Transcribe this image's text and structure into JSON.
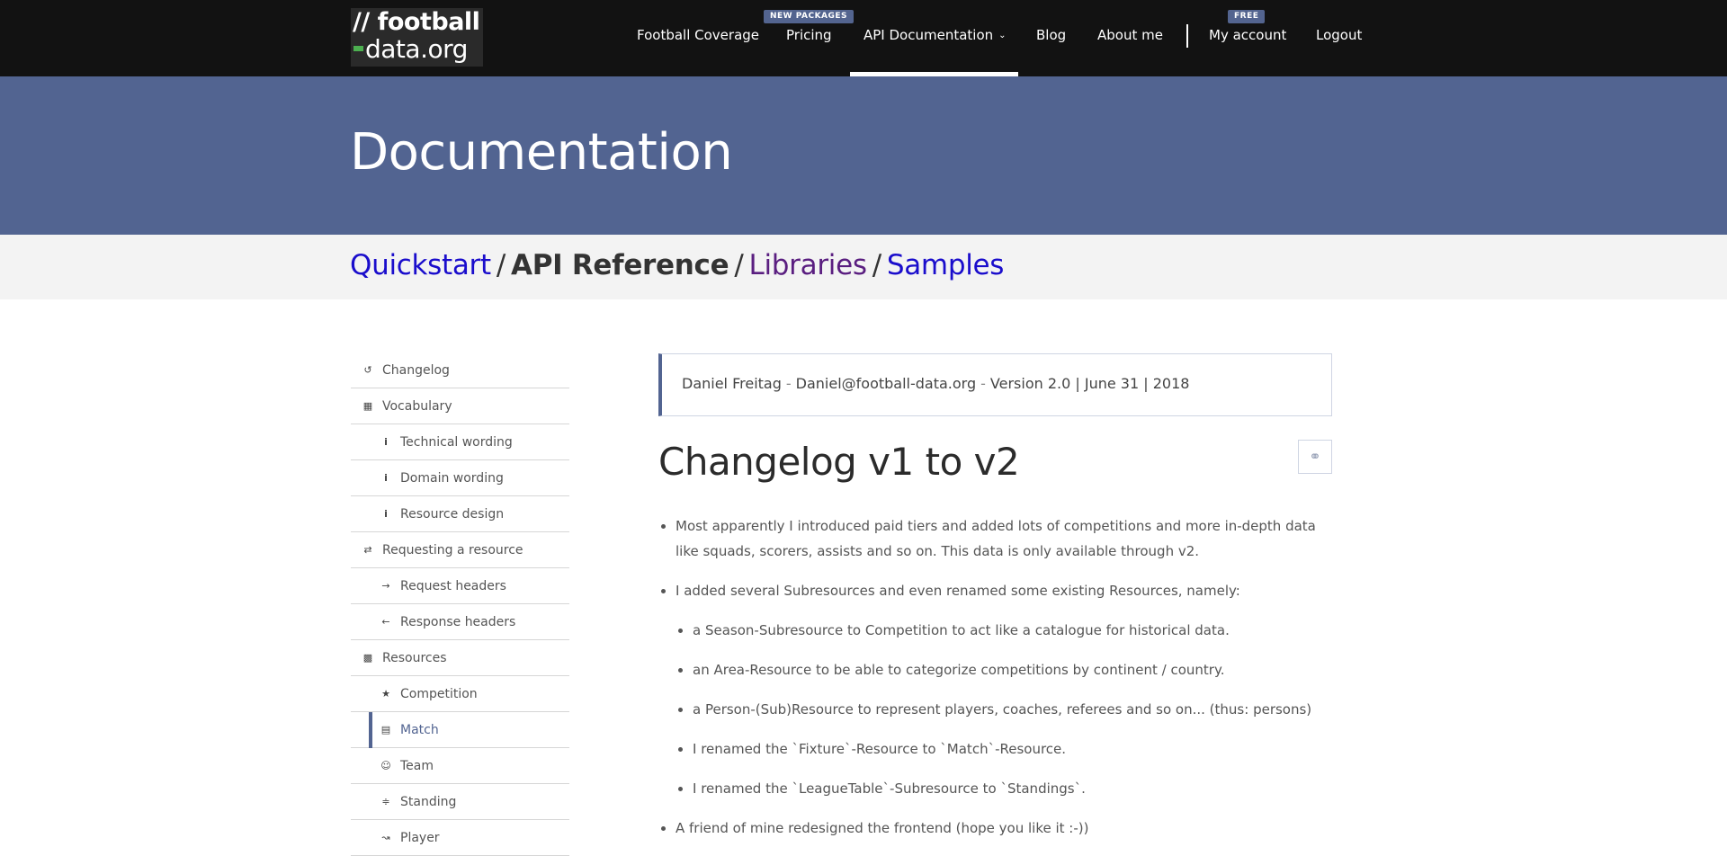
{
  "logo": {
    "line1": "// football",
    "line2": "data.org"
  },
  "nav": {
    "items": [
      {
        "label": "Football Coverage"
      },
      {
        "label": "Pricing",
        "badge": "NEW PACKAGES"
      },
      {
        "label": "API Documentation"
      },
      {
        "label": "Blog"
      },
      {
        "label": "About me"
      },
      {
        "label": "My account",
        "badge": "FREE"
      },
      {
        "label": "Logout"
      }
    ]
  },
  "hero": {
    "title": "Documentation"
  },
  "breadcrumb": {
    "items": [
      {
        "label": "Quickstart"
      },
      {
        "label": "API Reference"
      },
      {
        "label": "Libraries"
      },
      {
        "label": "Samples"
      }
    ],
    "separator": "/"
  },
  "sidebar": {
    "items": [
      {
        "label": "Changelog",
        "icon": "history-icon"
      },
      {
        "label": "Vocabulary",
        "icon": "language-icon"
      },
      {
        "label": "Technical wording",
        "icon": "info-icon"
      },
      {
        "label": "Domain wording",
        "icon": "info-icon"
      },
      {
        "label": "Resource design",
        "icon": "info-icon"
      },
      {
        "label": "Requesting a resource",
        "icon": "exchange-icon"
      },
      {
        "label": "Request headers",
        "icon": "arrow-right-icon"
      },
      {
        "label": "Response headers",
        "icon": "arrow-left-icon"
      },
      {
        "label": "Resources",
        "icon": "cubes-icon"
      },
      {
        "label": "Competition",
        "icon": "trophy-icon"
      },
      {
        "label": "Match",
        "icon": "calendar-icon",
        "active": true
      },
      {
        "label": "Team",
        "icon": "users-icon"
      },
      {
        "label": "Standing",
        "icon": "area-chart-icon"
      },
      {
        "label": "Player",
        "icon": "line-chart-icon"
      }
    ]
  },
  "author": {
    "name": "Daniel Freitag",
    "separator": "-",
    "email": "Daniel@football-data.org",
    "version_info": "Version 2.0 | June 31 | 2018"
  },
  "section": {
    "title": "Changelog v1 to v2",
    "anchor_icon": "link-icon",
    "items": [
      "Most apparently I introduced paid tiers and added lots of competitions and more in-depth data like squads, scorers, assists and so on. This data is only available through v2.",
      "I added several Subresources and even renamed some existing Resources, namely:",
      "A friend of mine redesigned the frontend (hope you like it :-))"
    ],
    "subitems": [
      "a Season-Subresource to Competition to act like a catalogue for historical data.",
      "an Area-Resource to be able to categorize competitions by continent / country.",
      "a Person-(Sub)Resource to represent players, coaches, referees and so on... (thus: persons)",
      "I renamed the `Fixture`-Resource to `Match`-Resource.",
      "I renamed the `LeagueTable`-Subresource to `Standings`."
    ]
  },
  "colors": {
    "navbar": "#121212",
    "hero": "#526491",
    "accent": "#526491",
    "logo_dash": "#4caf50",
    "link": "#1a0dcc",
    "visited_link": "#5a1e80"
  }
}
